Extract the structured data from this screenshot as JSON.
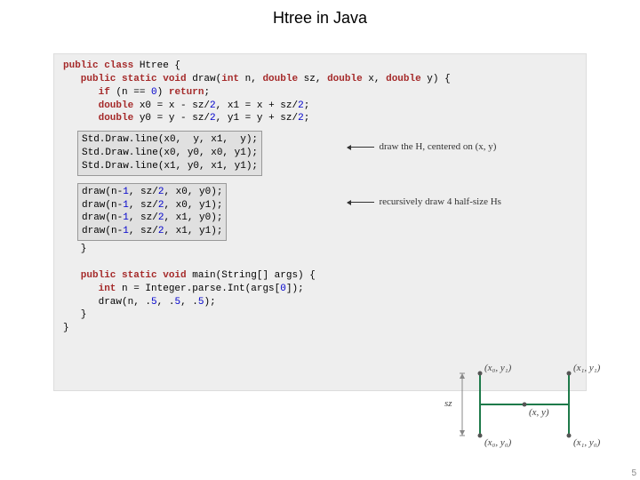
{
  "title": "Htree in Java",
  "code": {
    "line1_a": "public class",
    "line1_b": " Htree {",
    "line2_a": "   public static void",
    "line2_b": " draw(",
    "line2_c": "int",
    "line2_d": " n, ",
    "line2_e": "double",
    "line2_f": " sz, ",
    "line2_g": "double",
    "line2_h": " x, ",
    "line2_i": "double",
    "line2_j": " y) {",
    "line3_a": "      if",
    "line3_b": " (n == ",
    "line3_c": "0",
    "line3_d": ") ",
    "line3_e": "return",
    "line3_f": ";",
    "line4_a": "      double",
    "line4_b": " x0 = x - sz/",
    "line4_c": "2",
    "line4_d": ", x1 = x + sz/",
    "line4_e": "2",
    "line4_f": ";",
    "line5_a": "      double",
    "line5_b": " y0 = y - sz/",
    "line5_c": "2",
    "line5_d": ", y1 = y + sz/",
    "line5_e": "2",
    "line5_f": ";",
    "hl1_l1": "Std.Draw.line(x0,  y, x1,  y);",
    "hl1_l2": "Std.Draw.line(x0, y0, x0, y1);",
    "hl1_l3": "Std.Draw.line(x1, y0, x1, y1);",
    "hl2_l1_a": "draw(n-",
    "hl2_l1_b": "1",
    "hl2_l1_c": ", sz/",
    "hl2_l1_d": "2",
    "hl2_l1_e": ", x0, y0);",
    "hl2_l2_a": "draw(n-",
    "hl2_l2_b": "1",
    "hl2_l2_c": ", sz/",
    "hl2_l2_d": "2",
    "hl2_l2_e": ", x0, y1);",
    "hl2_l3_a": "draw(n-",
    "hl2_l3_b": "1",
    "hl2_l3_c": ", sz/",
    "hl2_l3_d": "2",
    "hl2_l3_e": ", x1, y0);",
    "hl2_l4_a": "draw(n-",
    "hl2_l4_b": "1",
    "hl2_l4_c": ", sz/",
    "hl2_l4_d": "2",
    "hl2_l4_e": ", x1, y1);",
    "close1": "   }",
    "main1_a": "   public static void",
    "main1_b": " main(String[] args) {",
    "main2_a": "      int",
    "main2_b": " n = Integer.parse.Int(args[",
    "main2_c": "0",
    "main2_d": "]);",
    "main3_a": "      draw(n, .",
    "main3_b": "5",
    "main3_c": ", .",
    "main3_d": "5",
    "main3_e": ", .",
    "main3_f": "5",
    "main3_g": ");",
    "close2": "   }",
    "close3": "}"
  },
  "annotation1": "draw the H, centered on (x, y)",
  "annotation2": "recursively draw 4 half-size Hs",
  "diagram": {
    "sz": "sz",
    "x0y1": "(x₀, y₁)",
    "x1y1": "(x₁, y₁)",
    "xy": "(x, y)",
    "x0y0": "(x₀, y₀)",
    "x1y0": "(x₁, y₀)"
  },
  "page_num": "5"
}
